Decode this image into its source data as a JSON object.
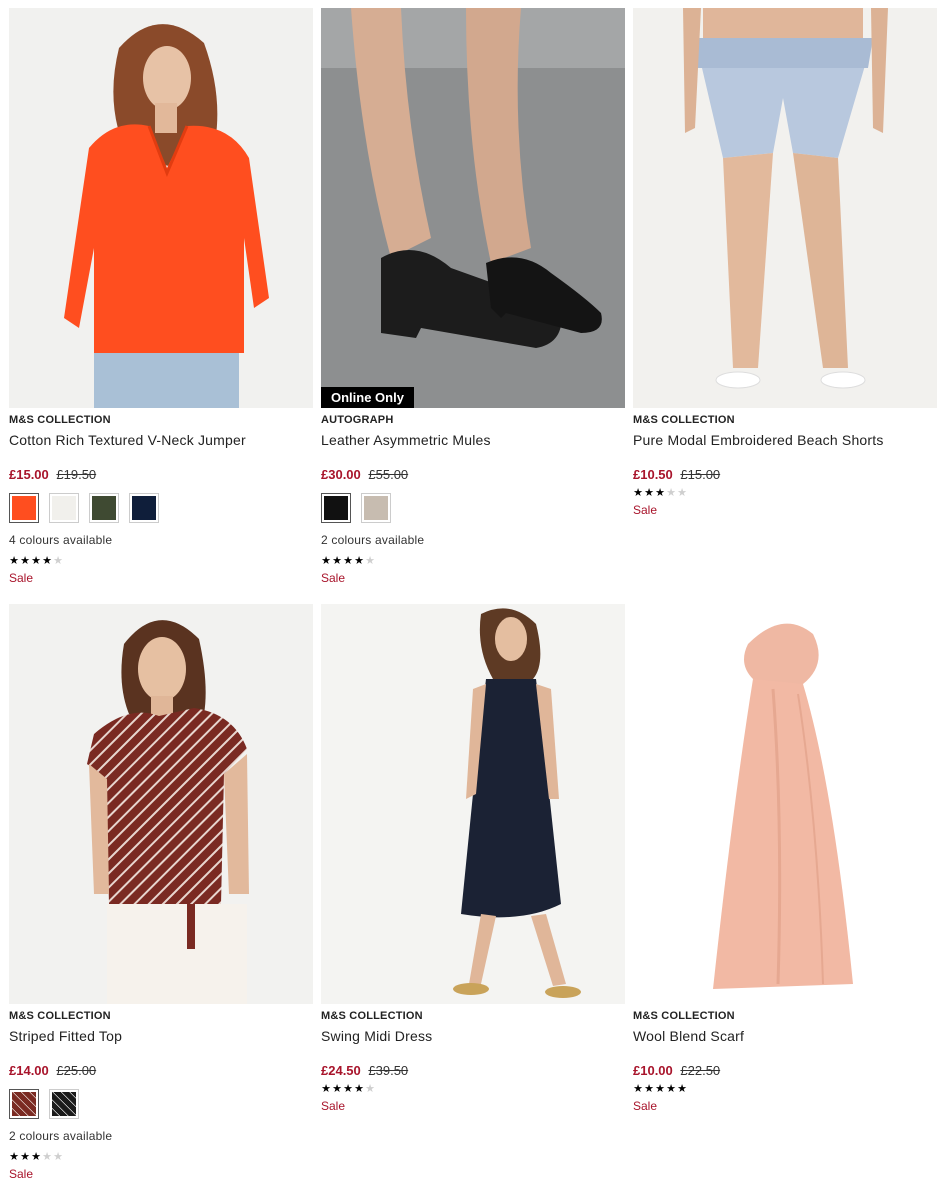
{
  "colors": {
    "sale_red": "#a8142b",
    "star_on": "#000000",
    "star_off": "#cfcfcf"
  },
  "products": [
    {
      "brand": "M&S COLLECTION",
      "name": "Cotton Rich Textured V-Neck Jumper",
      "price_now": "£15.00",
      "price_was": "£19.50",
      "swatches": [
        "#ff4e1f",
        "#f1f0ec",
        "#3f4a32",
        "#0f1e3a"
      ],
      "colours_text": "4 colours available",
      "rating": 3.5,
      "sale_label": "Sale",
      "image_icon": "orange-jumper-photo"
    },
    {
      "brand": "AUTOGRAPH",
      "name": "Leather Asymmetric Mules",
      "price_now": "£30.00",
      "price_was": "£55.00",
      "badge": "Online Only",
      "swatches": [
        "#111111",
        "#c7bcb0"
      ],
      "colours_text": "2 colours available",
      "rating": 4,
      "sale_label": "Sale",
      "image_icon": "black-mules-photo"
    },
    {
      "brand": "M&S COLLECTION",
      "name": "Pure Modal Embroidered Beach Shorts",
      "price_now": "£10.50",
      "price_was": "£15.00",
      "rating": 3,
      "sale_label": "Sale",
      "image_icon": "blue-shorts-photo"
    },
    {
      "brand": "M&S COLLECTION",
      "name": "Striped Fitted Top",
      "price_now": "£14.00",
      "price_was": "£25.00",
      "swatches": [
        "#7a2a22",
        "#1a1a1a"
      ],
      "colours_text": "2 colours available",
      "rating": 3,
      "sale_label": "Sale",
      "image_icon": "striped-top-photo"
    },
    {
      "brand": "M&S COLLECTION",
      "name": "Swing Midi Dress",
      "price_now": "£24.50",
      "price_was": "£39.50",
      "rating": 4,
      "sale_label": "Sale",
      "image_icon": "navy-dress-photo"
    },
    {
      "brand": "M&S COLLECTION",
      "name": "Wool Blend Scarf",
      "price_now": "£10.00",
      "price_was": "£22.50",
      "rating": 5,
      "sale_label": "Sale",
      "image_icon": "peach-scarf-photo"
    }
  ]
}
